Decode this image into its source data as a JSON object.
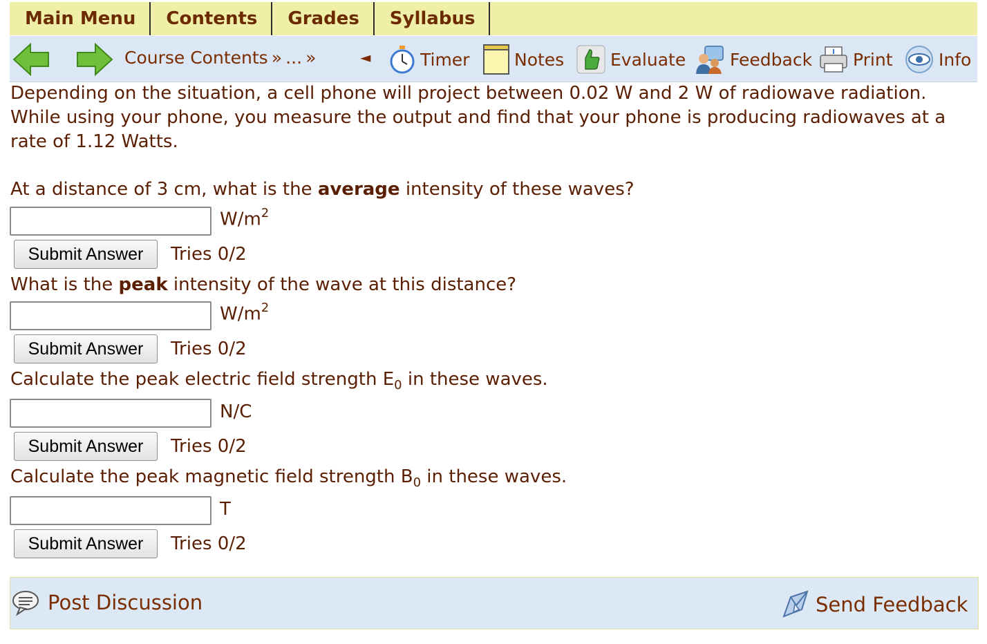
{
  "menu": {
    "items": [
      "Main Menu",
      "Contents",
      "Grades",
      "Syllabus"
    ]
  },
  "nav": {
    "breadcrumb": "Course Contents",
    "breadcrumb_sep1": "»",
    "ellipsis": "...",
    "breadcrumb_sep2": "»",
    "timer_arrow": "◄",
    "timer": "Timer",
    "notes": "Notes",
    "evaluate": "Evaluate",
    "feedback": "Feedback",
    "print": "Print",
    "info": "Info"
  },
  "problem": {
    "intro": "Depending on the situation, a cell phone will project between 0.02 W and 2 W of radiowave radiation. While using your phone, you measure the output and find that your phone is producing radiowaves at a rate of 1.12 Watts.",
    "questions": [
      {
        "pre": "At a distance of 3 cm, what is the ",
        "bold": "average",
        "post": " intensity of these waves?",
        "unit": "W/m",
        "unit_sup": "2",
        "answer": "",
        "submit": "Submit Answer",
        "tries": "Tries 0/2"
      },
      {
        "pre": "What is the ",
        "bold": "peak",
        "post": " intensity of the wave at this distance?",
        "unit": "W/m",
        "unit_sup": "2",
        "answer": "",
        "submit": "Submit Answer",
        "tries": "Tries 0/2"
      },
      {
        "pre": "Calculate the peak electric field strength E",
        "sub": "0",
        "post": " in these waves.",
        "unit": "N/C",
        "answer": "",
        "submit": "Submit Answer",
        "tries": "Tries 0/2"
      },
      {
        "pre": "Calculate the peak magnetic field strength B",
        "sub": "0",
        "post": " in these waves.",
        "unit": "T",
        "answer": "",
        "submit": "Submit Answer",
        "tries": "Tries 0/2"
      }
    ]
  },
  "footer": {
    "post_discussion": "Post Discussion",
    "send_feedback": "Send Feedback"
  },
  "colors": {
    "menu_bg": "#efefa8",
    "nav_bg": "#dbe7f5",
    "text": "#5a1e02",
    "link": "#7a2d00",
    "arrow_green": "#6fbf3a"
  }
}
